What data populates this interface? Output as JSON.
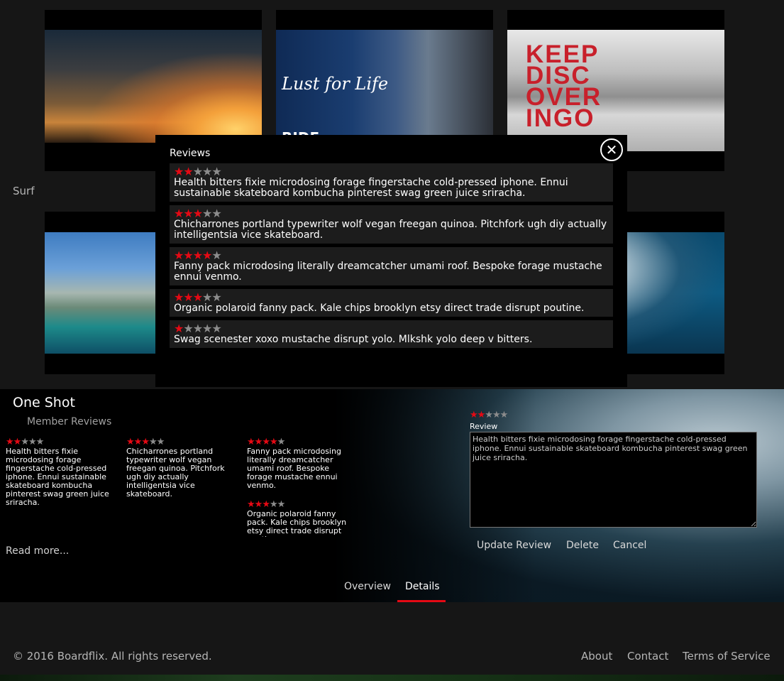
{
  "row_label": "Surf",
  "tiles_text": {
    "lust_for_life": "Lust for Life",
    "ride": "RIDE",
    "keep_discovering": "KEEP DISC OVER INGO"
  },
  "modal": {
    "title": "Reviews",
    "close_icon": "close-icon",
    "reviews": [
      {
        "rating": 2,
        "text": "Health bitters fixie microdosing forage fingerstache cold-pressed iphone. Ennui sustainable skateboard kombucha pinterest swag green juice sriracha."
      },
      {
        "rating": 3,
        "text": "Chicharrones portland typewriter wolf vegan freegan quinoa. Pitchfork ugh diy actually intelligentsia vice skateboard."
      },
      {
        "rating": 4,
        "text": "Fanny pack microdosing literally dreamcatcher umami roof. Bespoke forage mustache ennui venmo."
      },
      {
        "rating": 3,
        "text": "Organic polaroid fanny pack. Kale chips brooklyn etsy direct trade disrupt poutine."
      },
      {
        "rating": 1,
        "text": "Swag scenester xoxo mustache disrupt yolo. Mlkshk yolo deep v bitters."
      }
    ]
  },
  "details": {
    "title": "One Shot",
    "member_reviews_label": "Member Reviews",
    "columns": [
      [
        {
          "rating": 2,
          "text": "Health bitters fixie microdosing forage fingerstache cold-pressed iphone. Ennui sustainable skateboard kombucha pinterest swag green juice sriracha."
        }
      ],
      [
        {
          "rating": 3,
          "text": "Chicharrones portland typewriter wolf vegan freegan quinoa. Pitchfork ugh diy actually intelligentsia vice skateboard."
        }
      ],
      [
        {
          "rating": 4,
          "text": "Fanny pack microdosing literally dreamcatcher umami roof. Bespoke forage mustache ennui venmo."
        },
        {
          "rating": 3,
          "text": "Organic polaroid fanny pack. Kale chips brooklyn etsy direct trade disrupt poutine."
        }
      ]
    ],
    "read_more": "Read more...",
    "form": {
      "rating": 2,
      "label": "Review",
      "value": "Health bitters fixie microdosing forage fingerstache cold-pressed iphone. Ennui sustainable skateboard kombucha pinterest swag green juice sriracha.",
      "update_label": "Update Review",
      "delete_label": "Delete",
      "cancel_label": "Cancel"
    },
    "tabs": [
      {
        "label": "Overview",
        "active": false
      },
      {
        "label": "Details",
        "active": true
      }
    ]
  },
  "footer": {
    "copyright": "© 2016 Boardflix. All rights reserved.",
    "links": [
      "About",
      "Contact",
      "Terms of Service"
    ]
  },
  "colors": {
    "accent": "#e50914",
    "star_off": "#8c8c8c",
    "background": "#161616"
  }
}
